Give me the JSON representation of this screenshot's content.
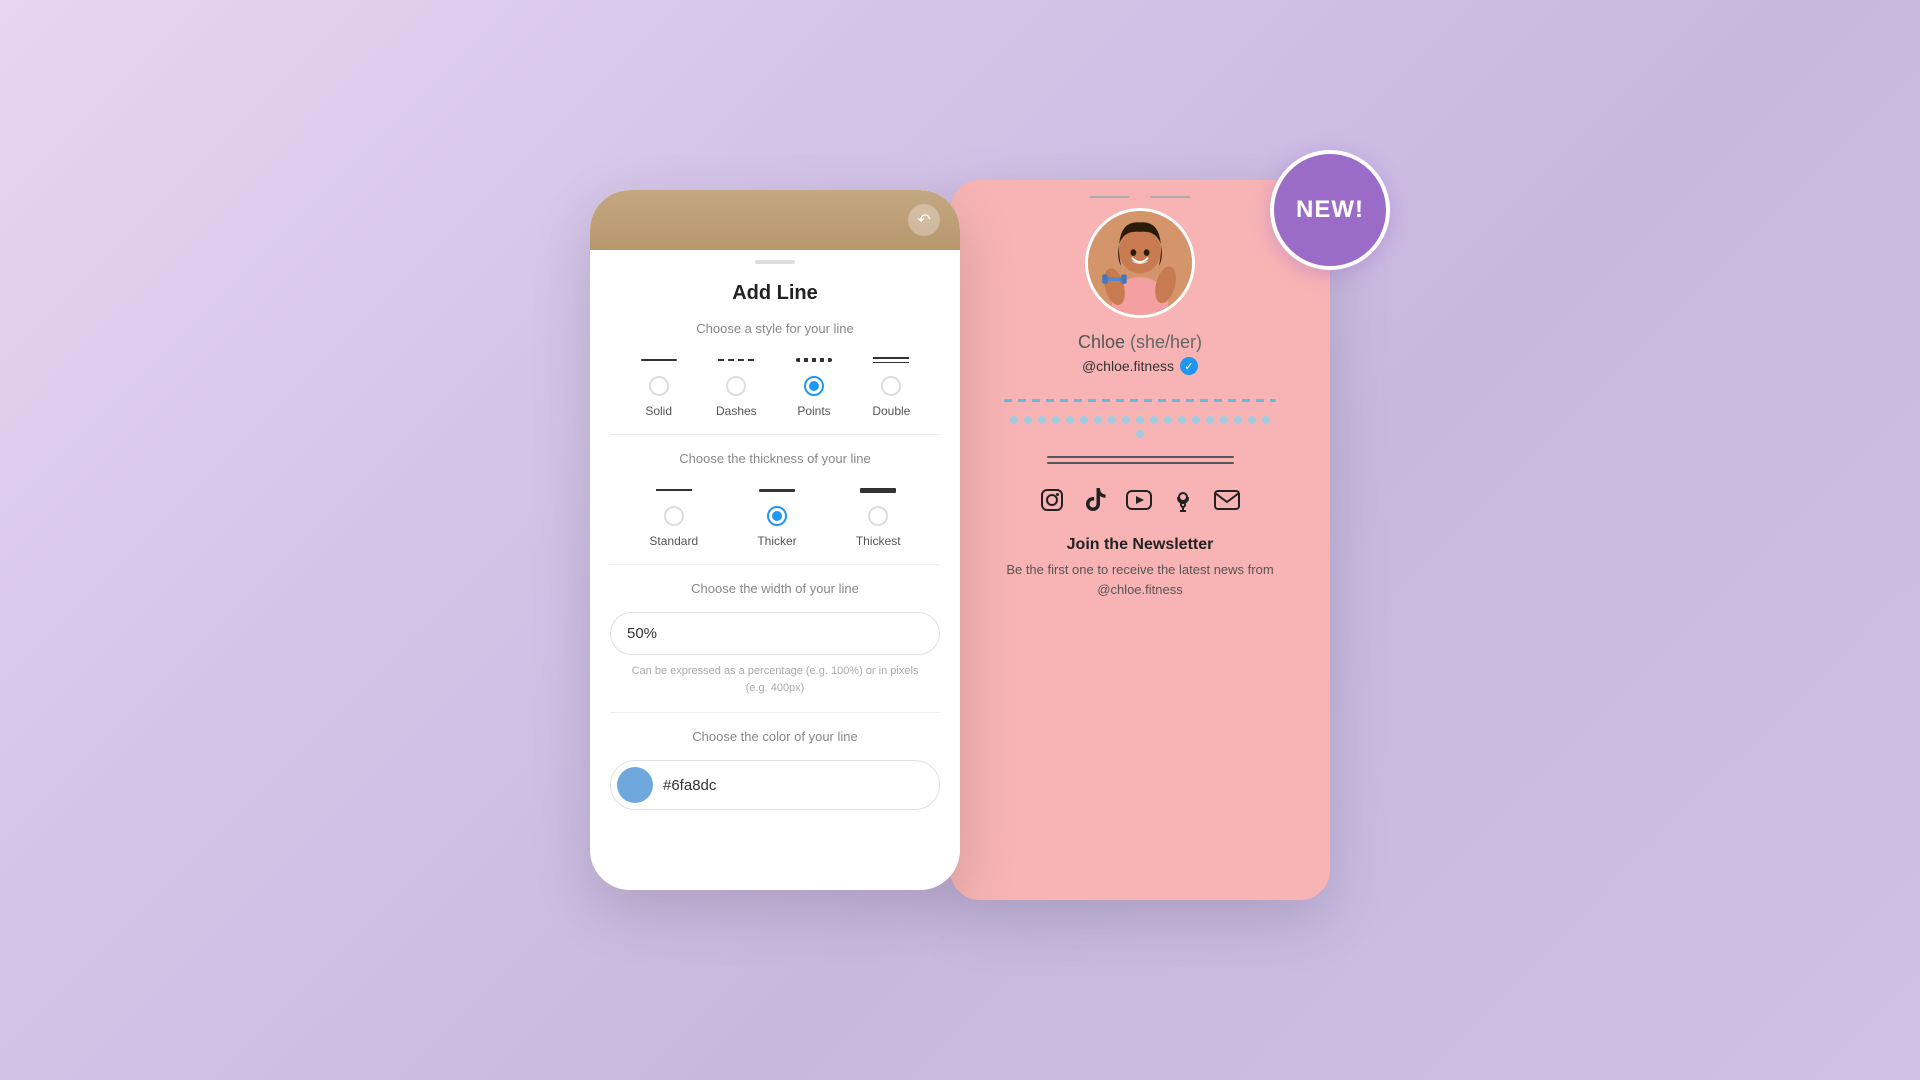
{
  "background": {
    "gradient": "linear-gradient(135deg, #e8d5f0 0%, #d4c5e8 50%, #c8b8e0 100%)"
  },
  "left_panel": {
    "title": "Add Line",
    "style_section": {
      "label": "Choose a style for your line",
      "options": [
        {
          "id": "solid",
          "label": "Solid",
          "selected": false
        },
        {
          "id": "dashes",
          "label": "Dashes",
          "selected": false
        },
        {
          "id": "points",
          "label": "Points",
          "selected": true
        },
        {
          "id": "double",
          "label": "Double",
          "selected": false
        }
      ]
    },
    "thickness_section": {
      "label": "Choose the thickness of your line",
      "options": [
        {
          "id": "standard",
          "label": "Standard",
          "selected": false
        },
        {
          "id": "thicker",
          "label": "Thicker",
          "selected": true
        },
        {
          "id": "thickest",
          "label": "Thickest",
          "selected": false
        }
      ]
    },
    "width_section": {
      "label": "Choose the width of your line",
      "value": "50%",
      "hint": "Can be expressed as a percentage (e.g. 100%) or in pixels\n(e.g. 400px)"
    },
    "color_section": {
      "label": "Choose the color of your line",
      "color": "#6fa8dc",
      "hex_value": "#6fa8dc"
    }
  },
  "right_panel": {
    "profile": {
      "name": "Chloe",
      "pronouns": "(she/her)",
      "handle": "@chloe.fitness",
      "verified": true
    },
    "newsletter": {
      "title": "Join the Newsletter",
      "description": "Be the first one to receive the latest news from\n@chloe.fitness"
    },
    "social_icons": [
      "instagram",
      "tiktok",
      "youtube",
      "podcast",
      "mail"
    ]
  },
  "new_badge": {
    "label": "NEW!"
  }
}
